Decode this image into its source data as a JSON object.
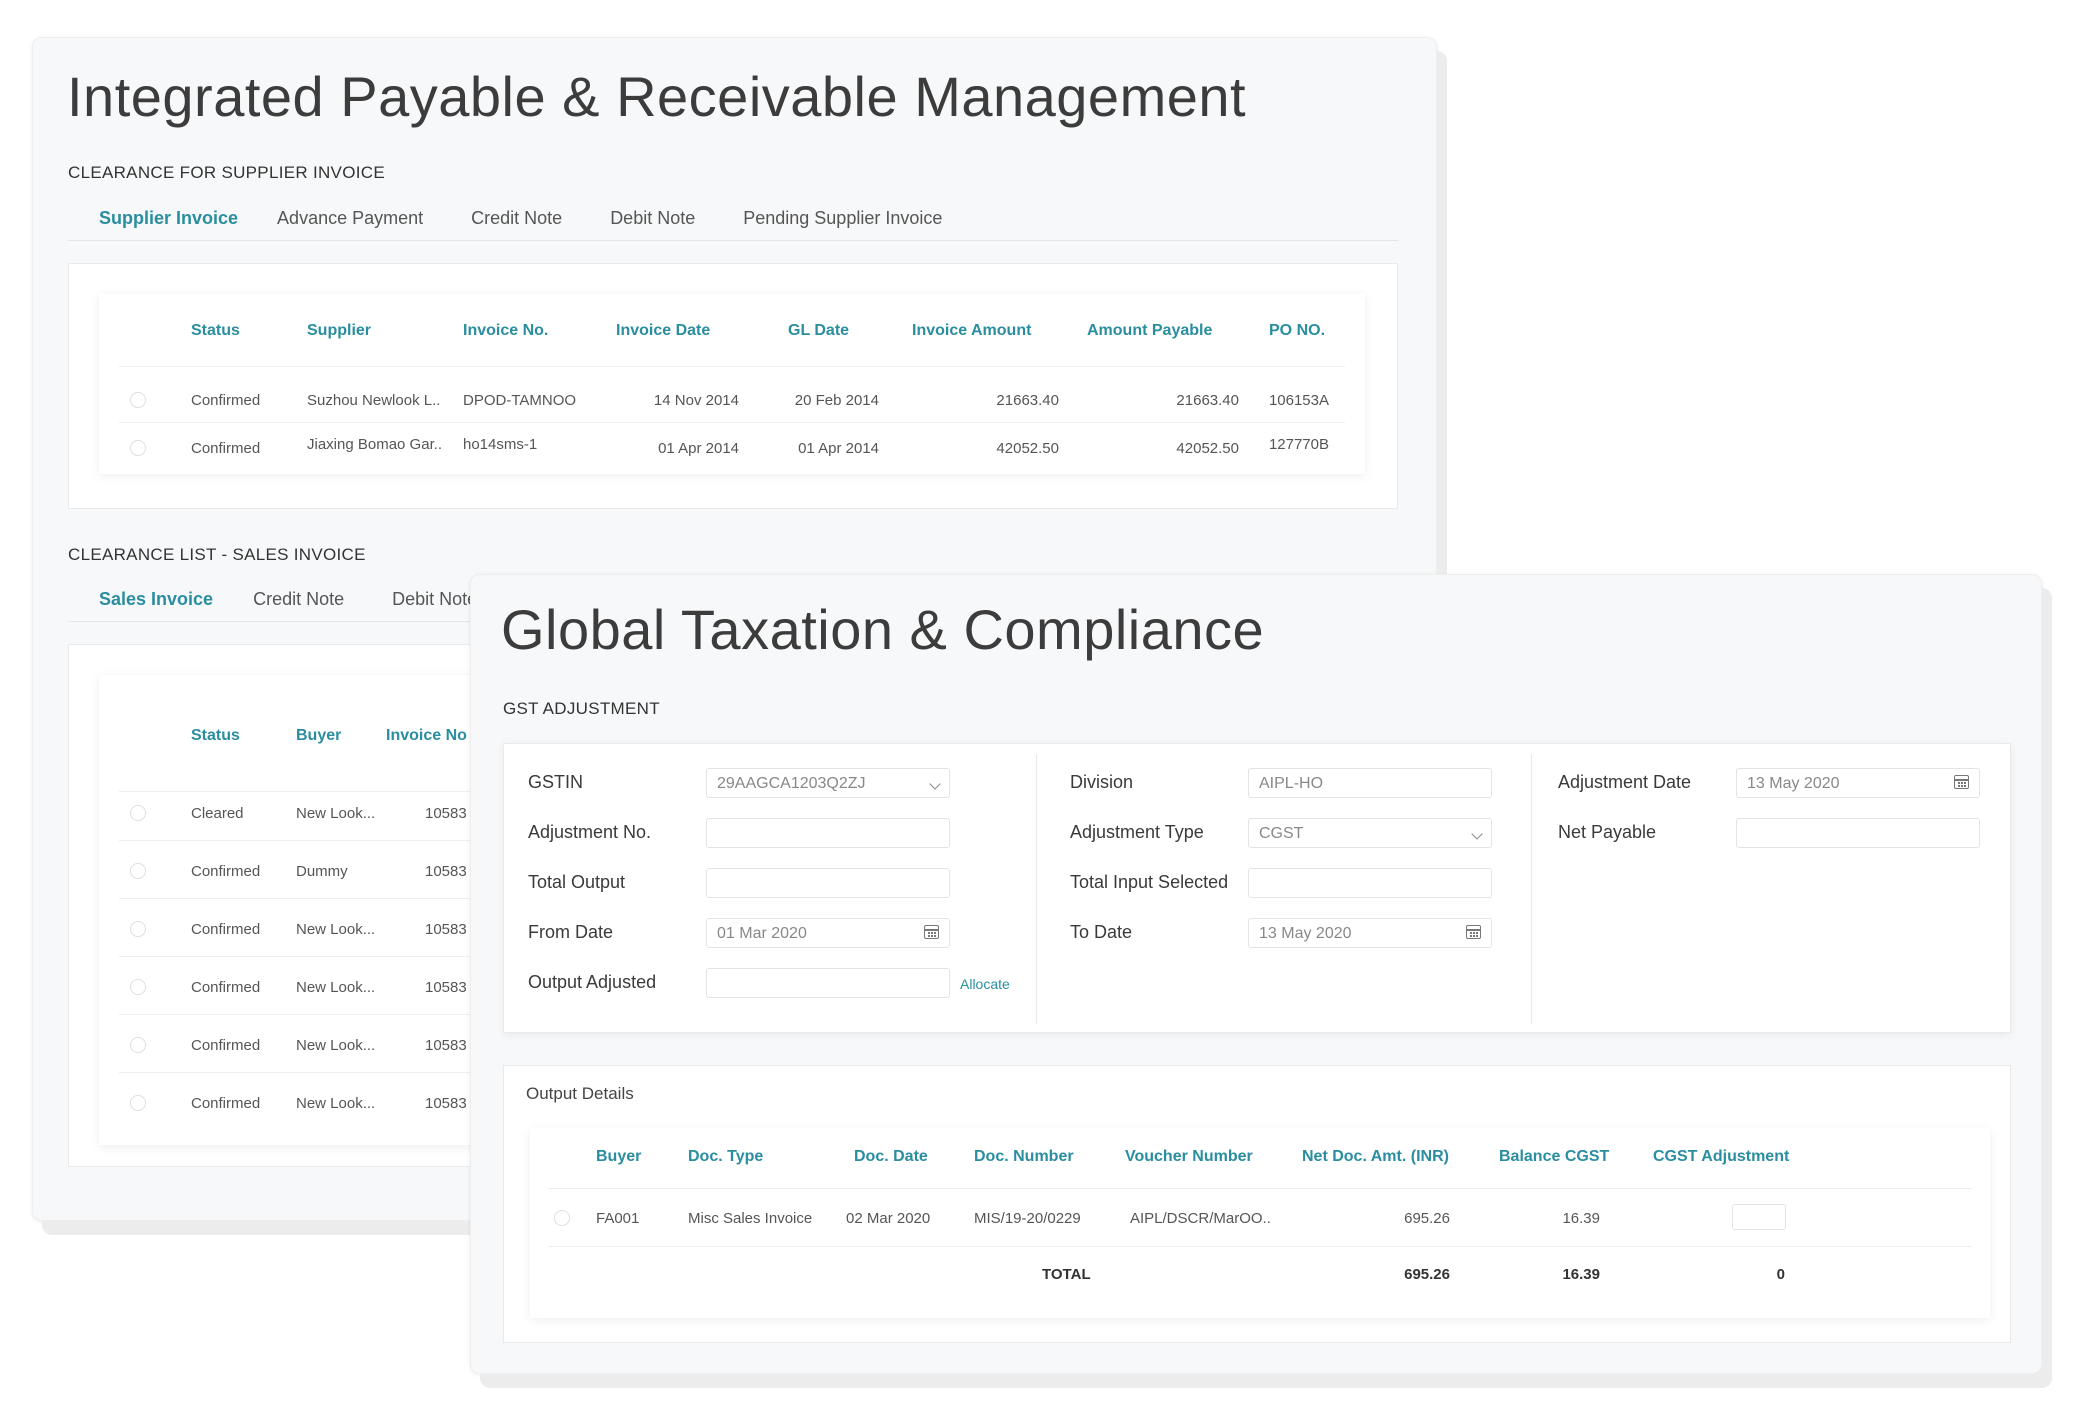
{
  "payable": {
    "title": "Integrated Payable & Receivable Management",
    "supplier_section": {
      "label": "CLEARANCE FOR SUPPLIER INVOICE",
      "tabs": [
        "Supplier Invoice",
        "Advance Payment",
        "Credit Note",
        "Debit Note",
        "Pending Supplier Invoice"
      ],
      "columns": [
        "Status",
        "Supplier",
        "Invoice No.",
        "Invoice Date",
        "GL Date",
        "Invoice Amount",
        "Amount Payable",
        "PO NO."
      ],
      "rows": [
        [
          "Confirmed",
          "Suzhou Newlook L..",
          "DPOD-TAMNOO",
          "14 Nov 2014",
          "20 Feb 2014",
          "21663.40",
          "21663.40",
          "106153A"
        ],
        [
          "Confirmed",
          "Jiaxing Bomao Gar..",
          "ho14sms-1",
          "01 Apr 2014",
          "01 Apr 2014",
          "42052.50",
          "42052.50",
          "127770B"
        ]
      ]
    },
    "sales_section": {
      "label": "CLEARANCE LIST - SALES INVOICE",
      "tabs": [
        "Sales Invoice",
        "Credit Note",
        "Debit Note"
      ],
      "columns": [
        "Status",
        "Buyer",
        "Invoice No"
      ],
      "rows": [
        [
          "Cleared",
          "New Look...",
          "10583"
        ],
        [
          "Confirmed",
          "Dummy",
          "10583"
        ],
        [
          "Confirmed",
          "New Look...",
          "10583"
        ],
        [
          "Confirmed",
          "New Look...",
          "10583"
        ],
        [
          "Confirmed",
          "New Look...",
          "10583"
        ],
        [
          "Confirmed",
          "New Look...",
          "10583"
        ]
      ]
    }
  },
  "tax": {
    "title": "Global Taxation & Compliance",
    "section_label": "GST ADJUSTMENT",
    "form": {
      "gstin_label": "GSTIN",
      "gstin_value": "29AAGCA1203Q2ZJ",
      "adj_no_label": "Adjustment No.",
      "adj_no_value": "",
      "total_output_label": "Total Output",
      "total_output_value": "",
      "from_date_label": "From Date",
      "from_date_value": "01 Mar 2020",
      "output_adjusted_label": "Output Adjusted",
      "output_adjusted_value": "",
      "allocate_label": "Allocate",
      "division_label": "Division",
      "division_value": "AIPL-HO",
      "adj_type_label": "Adjustment Type",
      "adj_type_value": "CGST",
      "total_input_label": "Total Input Selected",
      "total_input_value": "",
      "to_date_label": "To Date",
      "to_date_value": "13 May 2020",
      "adj_date_label": "Adjustment Date",
      "adj_date_value": "13 May 2020",
      "net_payable_label": "Net Payable",
      "net_payable_value": ""
    },
    "output_details": {
      "label": "Output Details",
      "columns": [
        "Buyer",
        "Doc. Type",
        "Doc. Date",
        "Doc. Number",
        "Voucher Number",
        "Net Doc. Amt. (INR)",
        "Balance CGST",
        "CGST Adjustment"
      ],
      "row": [
        "FA001",
        "Misc Sales Invoice",
        "02 Mar 2020",
        "MIS/19-20/0229",
        "AIPL/DSCR/MarOO..",
        "695.26",
        "16.39"
      ],
      "total_label": "TOTAL",
      "total_net": "695.26",
      "total_balance": "16.39",
      "total_adjustment": "0"
    }
  }
}
